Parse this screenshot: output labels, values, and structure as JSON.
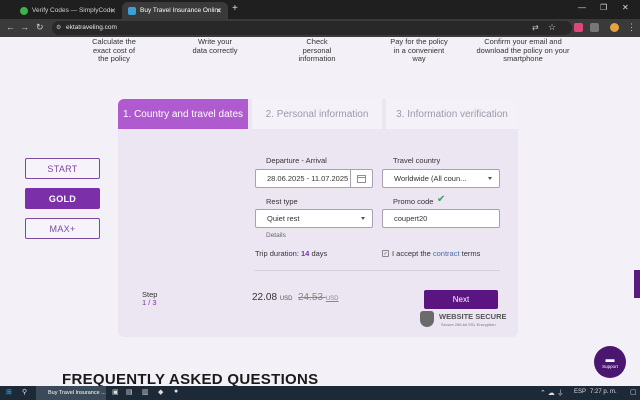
{
  "browser": {
    "tabs": [
      {
        "label": "Verify Codes — SimplyCodes"
      },
      {
        "label": "Buy Travel Insurance Online | Ekt"
      }
    ],
    "url": "ektatraveling.com"
  },
  "steps_intro": [
    {
      "text": "Calculate the exact cost of the policy"
    },
    {
      "text": "Write your data correctly"
    },
    {
      "text": "Check personal information"
    },
    {
      "text": "Pay for the policy in a convenient way"
    },
    {
      "text": "Confirm your email and download the policy on your smartphone"
    }
  ],
  "wizard": {
    "tabs": [
      "1. Country and travel dates",
      "2. Personal information",
      "3. Information verification"
    ],
    "plans": [
      "START",
      "GOLD",
      "MAX+"
    ],
    "departure_label": "Departure - Arrival",
    "departure_value": "28.06.2025 - 11.07.2025",
    "country_label": "Travel country",
    "country_value": "Worldwide (All coun...",
    "rest_label": "Rest type",
    "rest_value": "Quiet rest",
    "details_link": "Details",
    "promo_label": "Promo code",
    "promo_value": "coupert20",
    "duration_label": "Trip duration:",
    "duration_value": "14",
    "duration_unit": "days",
    "terms_prefix": "I accept the ",
    "terms_link": "contract",
    "terms_suffix": " terms",
    "step_label": "Step",
    "step_value": "1 / 3",
    "price": "22.08",
    "price_currency": "USD",
    "old_price": "24.53",
    "old_price_currency": "USD",
    "next_label": "Next",
    "secure_title": "WEBSITE SECURE",
    "secure_sub": "Secure 256-bit SSL Encryption"
  },
  "faq_heading": "FREQUENTLY ASKED QUESTIONS",
  "support_label": "Support",
  "taskbar": {
    "app_label": "Buy Travel Insurance ...",
    "lang": "ESP",
    "time": "7:27 p. m."
  },
  "colors": {
    "accent": "#b05ad0",
    "brand_dark": "#5a1580",
    "success": "#2fa84f"
  }
}
